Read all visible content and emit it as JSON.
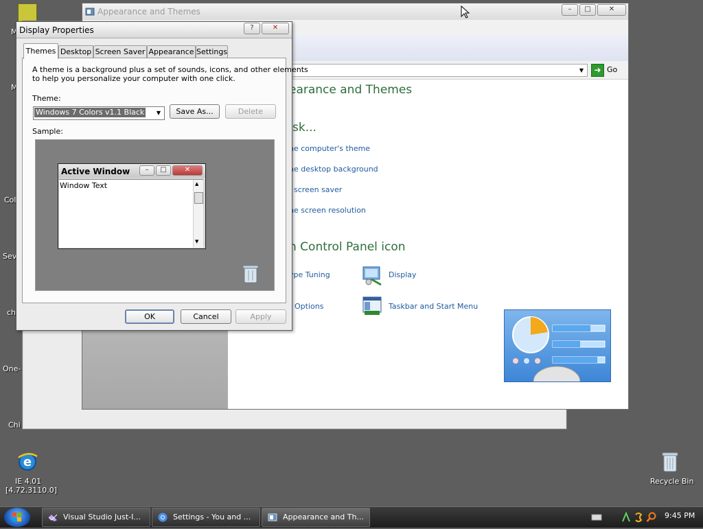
{
  "desktop": {
    "icons": [
      {
        "label": "IE 4.01"
      },
      {
        "label": "[4.72.3110.0]"
      },
      {
        "label": "Recycle Bin"
      }
    ],
    "partial_labels": [
      "M",
      "M",
      "Col",
      "Sev",
      "ch",
      "One-",
      "Chi"
    ]
  },
  "appearance_window": {
    "title": "Appearance and Themes",
    "go_label": "Go",
    "heading_main": "earance and Themes",
    "heading_task": "sk...",
    "tasks": [
      "he computer's theme",
      "he desktop background",
      "screen saver",
      "he screen resolution"
    ],
    "heading_icon": "n Control Panel icon",
    "icon_items": [
      {
        "label": "ype Tuning"
      },
      {
        "label": "Display"
      },
      {
        "label": "Options"
      },
      {
        "label": "Taskbar and Start Menu"
      }
    ],
    "caption_min": "–",
    "caption_max": "□",
    "caption_close": "✕"
  },
  "display_properties": {
    "title": "Display Properties",
    "help_glyph": "?",
    "close_glyph": "✕",
    "tabs": [
      "Themes",
      "Desktop",
      "Screen Saver",
      "Appearance",
      "Settings"
    ],
    "description_line1": "A theme is a background plus a set of sounds, icons, and other elements",
    "description_line2": "to help you personalize your computer with one click.",
    "theme_label": "Theme:",
    "theme_value": "Windows 7 Colors v1.1 Black",
    "save_as_label": "Save As...",
    "delete_label": "Delete",
    "sample_label": "Sample:",
    "sample_window_title": "Active Window",
    "sample_window_text": "Window Text",
    "ok_label": "OK",
    "cancel_label": "Cancel",
    "apply_label": "Apply"
  },
  "taskbar": {
    "tasks": [
      {
        "label": "Visual Studio Just-I..."
      },
      {
        "label": "Settings - You and ..."
      },
      {
        "label": "Appearance and Th..."
      }
    ],
    "clock": "9:45 PM"
  }
}
